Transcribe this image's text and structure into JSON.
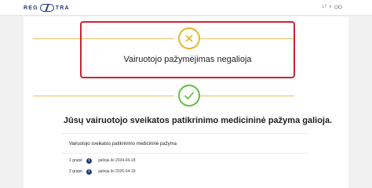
{
  "header": {
    "logo_text_left": "REG",
    "logo_text_right": "TRA",
    "language": "LT",
    "language_caret": "▾",
    "accessibility_icon": "eye-icon"
  },
  "status_error": {
    "icon": "x-circle-icon",
    "message": "Vairuotojo pažymėjimas negalioja",
    "color": "#cc2434",
    "icon_color": "#e6b820"
  },
  "status_success": {
    "icon": "check-circle-icon",
    "message": "Jūsų vairuotojo sveikatos patikrinimo medicininė pažyma galioja.",
    "icon_color": "#5fbf3b"
  },
  "medical_card": {
    "title": "Vairuotojo sveikatos patikrinimo medicininė pažyma",
    "groups": [
      {
        "label": "1 grupė",
        "info": "i",
        "validity": "galioja iki 2034-04-18"
      },
      {
        "label": "2 grupė",
        "info": "i",
        "validity": "galioja iki 2026-04-18"
      }
    ]
  }
}
